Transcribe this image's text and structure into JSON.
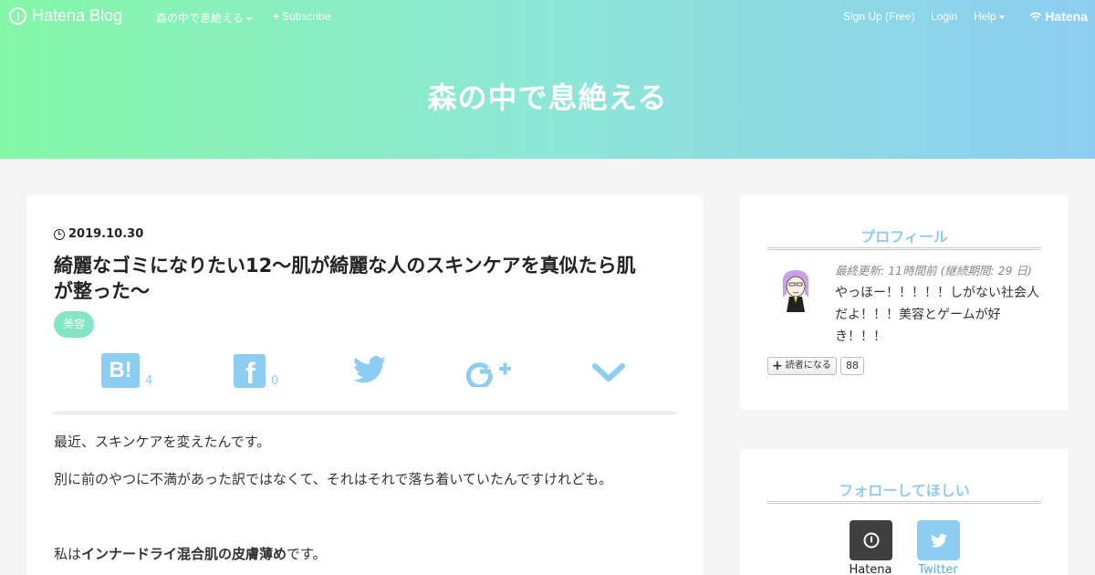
{
  "topbar": {
    "logo_text": "Hatena Blog",
    "blog_menu": "森の中で息絶える",
    "subscribe": "Subscribe",
    "signup": "Sign Up (Free)",
    "login": "Login",
    "help": "Help",
    "brand": "Hatena"
  },
  "header": {
    "title": "森の中で息絶える"
  },
  "entry": {
    "date": "2019.10.30",
    "title_line1": "綺麗なゴミになりたい12～肌が綺麗な人のスキンケアを真似たら肌",
    "title_line2": "が整った～",
    "category": "美容",
    "share": {
      "hatena_count": "4",
      "facebook_count": "0"
    },
    "paragraphs": {
      "p1": "最近、スキンケアを変えたんです。",
      "p2": "別に前のやつに不満があった訳ではなくて、それはそれで落ち着いていたんですけれども。",
      "p3_prefix": "私は",
      "p3_bold": "インナードライ混合肌の皮膚薄め",
      "p3_suffix": "です。"
    }
  },
  "profile": {
    "heading": "プロフィール",
    "updated": "最終更新: 11時間前 (継続期間: 29 日)",
    "bio": "やっほー！！！！！しがない社会人だよ！！！美容とゲームが好き！！！",
    "reader_button": "読者になる",
    "reader_count": "88"
  },
  "follow": {
    "heading": "フォローしてほしい",
    "hatena_label": "Hatena",
    "twitter_label": "Twitter"
  },
  "colors": {
    "header_gradient_start": "#84f7a7",
    "header_gradient_end": "#8dcdf2",
    "accent": "#8dcdf2",
    "tag": "#84e5c4"
  }
}
